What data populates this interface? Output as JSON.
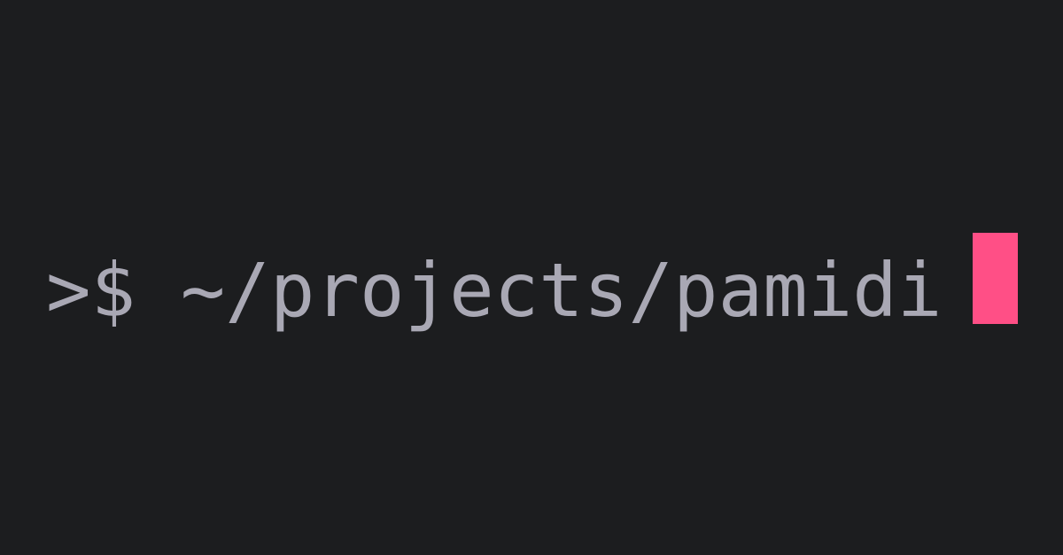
{
  "terminal": {
    "prompt_symbol": ">$ ",
    "path": "~/projects/pamidi",
    "colors": {
      "background": "#1c1d1f",
      "text": "#a9a8b4",
      "cursor": "#ff4f86"
    }
  }
}
